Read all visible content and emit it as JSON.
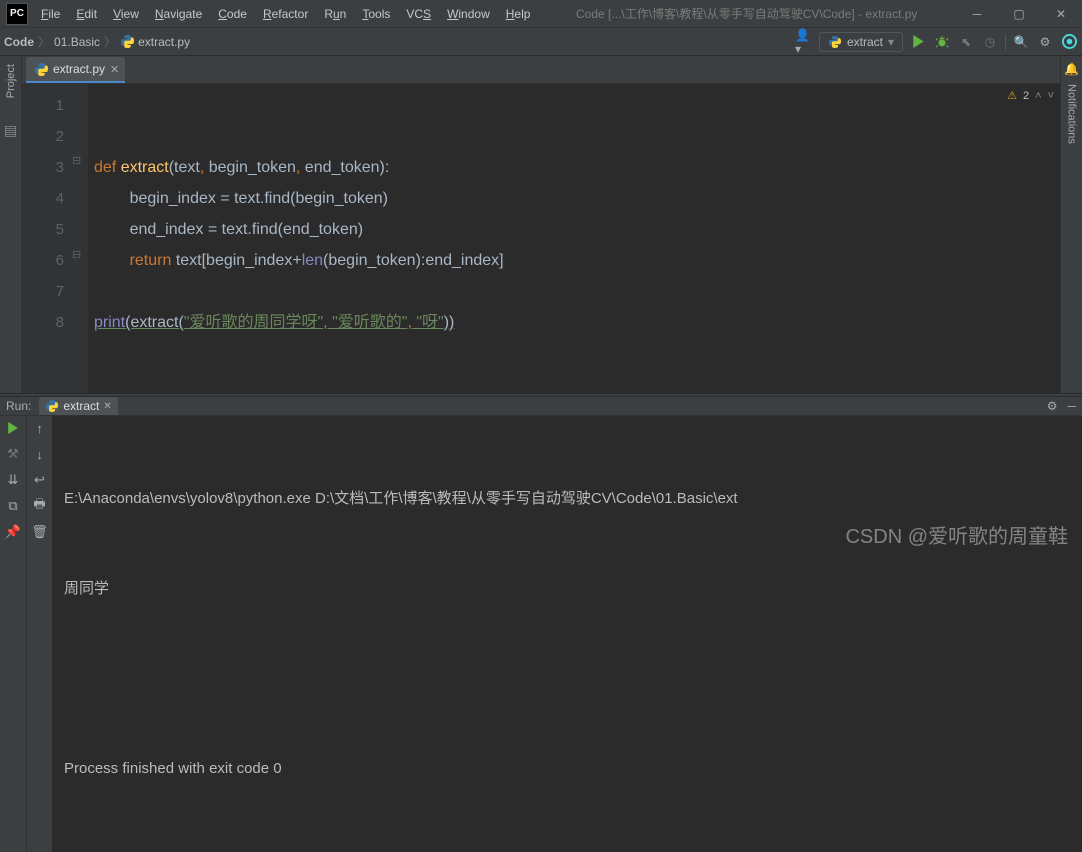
{
  "title": "Code [...\\工作\\博客\\教程\\从零手写自动驾驶CV\\Code] - extract.py",
  "logo": "PC",
  "menu": [
    "File",
    "Edit",
    "View",
    "Navigate",
    "Code",
    "Refactor",
    "Run",
    "Tools",
    "VCS",
    "Window",
    "Help"
  ],
  "breadcrumbs": {
    "root": "Code",
    "folder": "01.Basic",
    "file": "extract.py"
  },
  "runconfig": "extract",
  "tab": {
    "name": "extract.py"
  },
  "inspection": {
    "warn_count": "2"
  },
  "gutter": [
    "1",
    "2",
    "3",
    "4",
    "5",
    "6",
    "7",
    "8"
  ],
  "code": {
    "l3_def": "def ",
    "l3_fn": "extract",
    "l3_sig": "(text",
    "l3_c1": ", ",
    "l3_p2": "begin_token",
    "l3_c2": ", ",
    "l3_p3": "end_token):",
    "l4_a": "        begin_index = text.find(begin_token)",
    "l5_a": "        end_index = text.find(end_token)",
    "l6_ret": "        return ",
    "l6_b": "text[begin_index+",
    "l6_len": "len",
    "l6_c": "(begin_token):end_index]",
    "l8_p": "print",
    "l8_a": "(extract(",
    "l8_s1": "\"爱听歌的周同学呀\"",
    "l8_c1": ", ",
    "l8_s2": "\"爱听歌的\"",
    "l8_c2": ", ",
    "l8_s3": "\"呀\"",
    "l8_e": "))"
  },
  "sidebar_left": {
    "project": "Project"
  },
  "sidebar_right": {
    "notifications": "Notifications"
  },
  "run": {
    "title": "Run:",
    "tab": "extract",
    "line1": "E:\\Anaconda\\envs\\yolov8\\python.exe D:\\文档\\工作\\博客\\教程\\从零手写自动驾驶CV\\Code\\01.Basic\\ext",
    "line2": "周同学",
    "line3": "",
    "line4": "Process finished with exit code 0"
  },
  "watermark": "CSDN @爱听歌的周童鞋"
}
